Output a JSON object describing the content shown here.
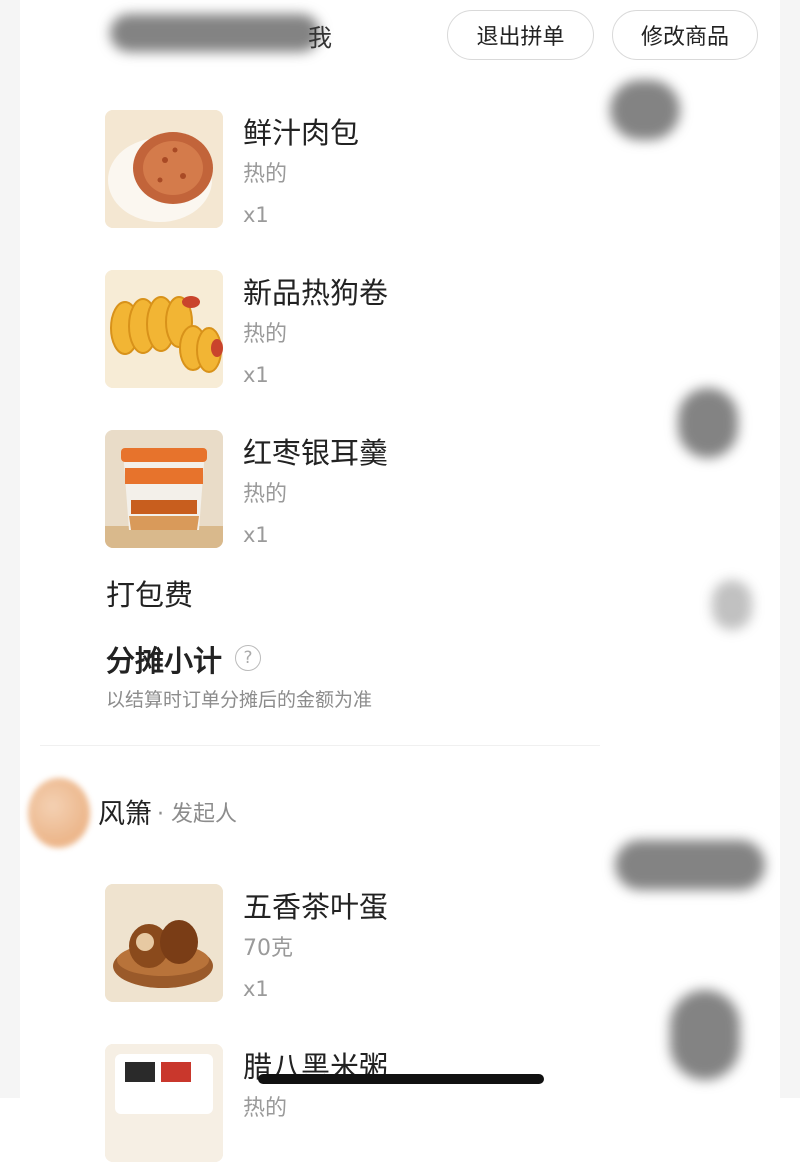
{
  "header": {
    "partial_title": "我",
    "exit_button": "退出拼单",
    "edit_button": "修改商品"
  },
  "items": [
    {
      "name": "鲜汁肉包",
      "spec": "热的",
      "qty": "x1",
      "thumb_icon": "meat-bun-image"
    },
    {
      "name": "新品热狗卷",
      "spec": "热的",
      "qty": "x1",
      "thumb_icon": "hotdog-roll-image"
    },
    {
      "name": "红枣银耳羹",
      "spec": "热的",
      "qty": "x1",
      "thumb_icon": "jujube-soup-cup-image"
    }
  ],
  "packaging_fee_label": "打包费",
  "subtotal": {
    "label": "分摊小计",
    "help_icon": "?",
    "note": "以结算时订单分摊后的金额为准"
  },
  "member": {
    "name": "风箫",
    "role": "· 发起人",
    "items": [
      {
        "name": "五香茶叶蛋",
        "spec": "70克",
        "qty": "x1",
        "thumb_icon": "tea-egg-image"
      },
      {
        "name": "腊八黑米粥",
        "spec": "热的",
        "qty": "",
        "thumb_icon": "black-rice-porridge-image"
      }
    ]
  },
  "colors": {
    "primary_text": "#222222",
    "secondary_text": "#9a9a9a",
    "button_border": "#d9d9d9"
  }
}
